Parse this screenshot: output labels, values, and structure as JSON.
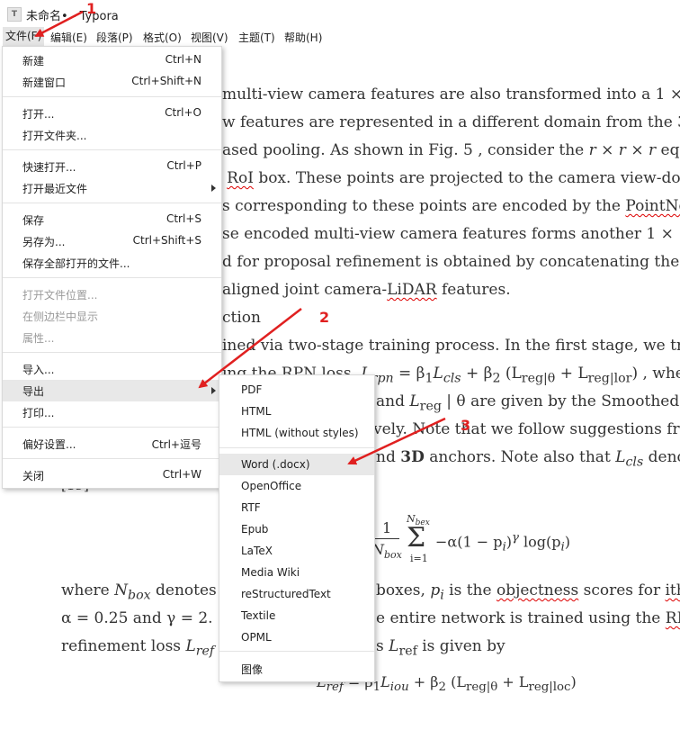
{
  "window": {
    "title": "未命名• - Typora",
    "app_icon": "T"
  },
  "menubar": [
    {
      "label": "文件(F)"
    },
    {
      "label": "编辑(E)"
    },
    {
      "label": "段落(P)"
    },
    {
      "label": "格式(O)"
    },
    {
      "label": "视图(V)"
    },
    {
      "label": "主题(T)"
    },
    {
      "label": "帮助(H)"
    }
  ],
  "file_menu": {
    "items": [
      {
        "label": "新建",
        "shortcut": "Ctrl+N"
      },
      {
        "label": "新建窗口",
        "shortcut": "Ctrl+Shift+N"
      },
      {
        "label": "打开...",
        "shortcut": "Ctrl+O"
      },
      {
        "label": "打开文件夹...",
        "shortcut": ""
      },
      {
        "label": "快速打开...",
        "shortcut": "Ctrl+P"
      },
      {
        "label": "打开最近文件",
        "shortcut": ""
      },
      {
        "label": "保存",
        "shortcut": "Ctrl+S"
      },
      {
        "label": "另存为...",
        "shortcut": "Ctrl+Shift+S"
      },
      {
        "label": "保存全部打开的文件...",
        "shortcut": ""
      },
      {
        "label": "打开文件位置...",
        "shortcut": ""
      },
      {
        "label": "在侧边栏中显示",
        "shortcut": ""
      },
      {
        "label": "属性...",
        "shortcut": ""
      },
      {
        "label": "导入...",
        "shortcut": ""
      },
      {
        "label": "导出",
        "shortcut": ""
      },
      {
        "label": "打印...",
        "shortcut": ""
      },
      {
        "label": "偏好设置...",
        "shortcut": "Ctrl+逗号"
      },
      {
        "label": "关闭",
        "shortcut": "Ctrl+W"
      }
    ]
  },
  "export_menu": {
    "items": [
      {
        "label": "PDF"
      },
      {
        "label": "HTML"
      },
      {
        "label": "HTML (without styles)"
      },
      {
        "label": "Word (.docx)"
      },
      {
        "label": "OpenOffice"
      },
      {
        "label": "RTF"
      },
      {
        "label": "Epub"
      },
      {
        "label": "LaTeX"
      },
      {
        "label": "Media Wiki"
      },
      {
        "label": "reStructuredText"
      },
      {
        "label": "Textile"
      },
      {
        "label": "OPML"
      },
      {
        "label": "图像"
      }
    ]
  },
  "annotations": {
    "step1": "1",
    "step2": "2",
    "step3": "3",
    "color": "#e02020"
  },
  "document": {
    "l1": "multi-view camera features are also transformed into a 1 ×",
    "l2": "w features are represented in a different domain from the 3",
    "l3a": "ased pooling. As shown in Fig. 5 , consider the",
    "l3b": "r × r × r",
    "l3c": "equ",
    "l4a": "D",
    "l4b": "RoI",
    "l4c": "box. These points are projected to the camera view-do",
    "l5a": "s corresponding to these points are encoded by the",
    "l5b": "PointNet",
    "l6": "se encoded multi-view camera features forms another 1 × 1",
    "l7": "d for proposal refinement is obtained by concatenating these",
    "l8a": "aligned joint camera-",
    "l8b": "LiDAR",
    "l8c": "features.",
    "l9": "ction",
    "l10": "ined via two-stage training process. In the first stage, we tra",
    "l11a": "ing the RPN loss,",
    "l11b": "L",
    "l11c": "rpn",
    "l11d": "= β",
    "l11e": "L",
    "l11f": "cls",
    "l11g": "+ β",
    "l11h": "(L",
    "l11i": "reg|θ",
    "l11j": "+ L",
    "l11k": "reg|lor",
    "l11l": ") , whe",
    "l12a": "and",
    "l12b": "L",
    "l12c": "reg",
    "l12d": "| θ are given by the Smoothed-",
    "l13a": "vely. Note that we follow suggestions fro",
    "l14a": "nd",
    "l14b": "3D",
    "l14c": "anchors. Note also that",
    "l14d": "L",
    "l14e": "cls",
    "l14f": "denot",
    "l15": "[19]",
    "f1a": "1",
    "f1b": "N",
    "f1c": "box",
    "f1d": "N",
    "f1e": "bex",
    "f1f": "Σ",
    "f1g": "i=1",
    "f1h": "−α(1 − p",
    "f1i": "i",
    "f1j": ")",
    "f1k": "γ",
    "f1l": "log(p",
    "f1m": "i",
    "f1n": ")",
    "l16a": "where",
    "l16b": "N",
    "l16c": "box",
    "l16d": "denotes t",
    "l16e": "boxes,",
    "l16f": "p",
    "l16g": "i",
    "l16h": "is the",
    "l16i": "objectness",
    "l16j": "scores for",
    "l16k": "ith",
    "l16l": "l",
    "l17a": "α = 0.25 and γ = 2.",
    "l17b": "e entire network is trained using the",
    "l17c": "RPN",
    "l18a": "refinement loss",
    "l18b": "L",
    "l18c": "ref",
    "l18d": "s",
    "l18e": "L",
    "l18f": "ref",
    "l18g": "is given by",
    "f2a": "L",
    "f2b": "ref",
    "f2c": "= β",
    "f2d": "L",
    "f2e": "iou",
    "f2f": "+ β",
    "f2g": "(L",
    "f2h": "reg|θ",
    "f2i": "+ L",
    "f2j": "reg|loc",
    "f2k": ")"
  }
}
